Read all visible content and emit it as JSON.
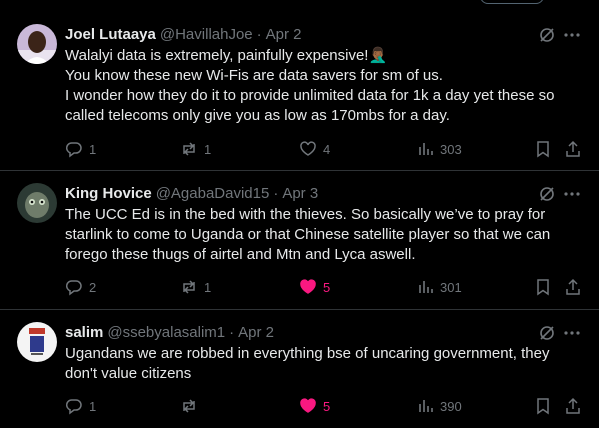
{
  "tweets": [
    {
      "name": "Joel Lutaaya",
      "handle": "@HavillahJoe",
      "time": "Apr 2",
      "lines": [
        "Walalyi data is extremely, painfully expensive!🤦🏾‍♂️",
        "You know these new Wi-Fis are data savers for sm of us.",
        "I wonder how they do it to provide unlimited data for 1k a day yet these so",
        "called telecoms only give you as low as 170mbs for a day."
      ],
      "replies": "1",
      "reposts": "1",
      "likes": "4",
      "liked": false,
      "views": "303"
    },
    {
      "name": "King Hovice",
      "handle": "@AgabaDavid15",
      "time": "Apr 3",
      "lines": [
        "The UCC Ed is in the bed with the thieves. So basically we’ve to pray for",
        "starlink to come to Uganda or that Chinese satellite player so that we can",
        "forego these thugs of airtel and Mtn and Lyca aswell."
      ],
      "replies": "2",
      "reposts": "1",
      "likes": "5",
      "liked": true,
      "views": "301"
    },
    {
      "name": "salim",
      "handle": "@ssebyalasalim1",
      "time": "Apr 2",
      "lines": [
        "Ugandans we are robbed in everything bse of uncaring government, they",
        "don't value citizens"
      ],
      "replies": "1",
      "reposts": "",
      "likes": "5",
      "liked": true,
      "views": "390"
    }
  ],
  "colors": {
    "background": "#000000",
    "text": "#e7e9ea",
    "muted": "#71767b",
    "like": "#f91880",
    "divider": "#2f3336"
  },
  "icons": [
    "grok-icon",
    "more-icon",
    "reply-icon",
    "repost-icon",
    "like-icon",
    "views-icon",
    "bookmark-icon",
    "share-icon"
  ]
}
